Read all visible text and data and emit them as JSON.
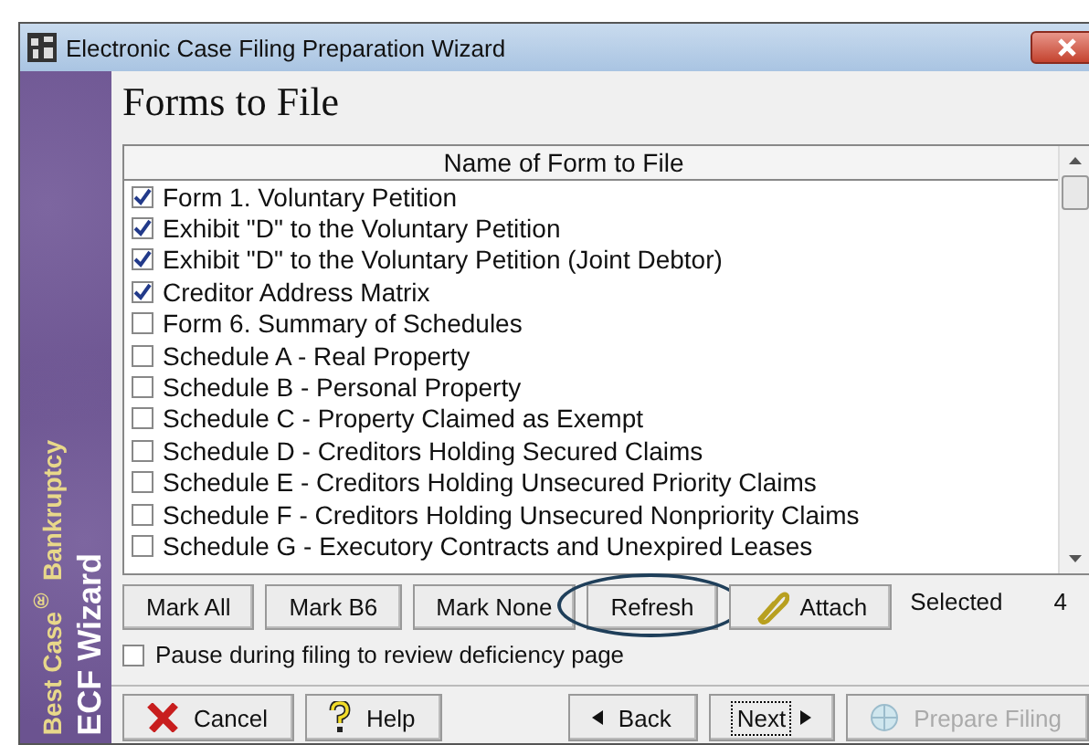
{
  "window": {
    "title": "Electronic Case Filing Preparation Wizard"
  },
  "sidebar": {
    "brand": "Best Case$^{®}$ Bankruptcy",
    "product": "ECF Wizard"
  },
  "heading": "Forms to File",
  "list": {
    "column": "Name of Form to File",
    "rows": [
      {
        "label": "Form 1. Voluntary Petition",
        "checked": true
      },
      {
        "label": "Exhibit \"D\" to the Voluntary Petition",
        "checked": true
      },
      {
        "label": "Exhibit \"D\" to the Voluntary Petition (Joint Debtor)",
        "checked": true
      },
      {
        "label": "Creditor Address Matrix",
        "checked": true
      },
      {
        "label": "Form 6. Summary of Schedules",
        "checked": false
      },
      {
        "label": "Schedule A - Real Property",
        "checked": false
      },
      {
        "label": "Schedule B - Personal Property",
        "checked": false
      },
      {
        "label": "Schedule C - Property Claimed as Exempt",
        "checked": false
      },
      {
        "label": "Schedule D - Creditors Holding Secured Claims",
        "checked": false
      },
      {
        "label": "Schedule E - Creditors Holding Unsecured Priority Claims",
        "checked": false
      },
      {
        "label": "Schedule F - Creditors Holding Unsecured Nonpriority Claims",
        "checked": false
      },
      {
        "label": "Schedule G - Executory Contracts and Unexpired Leases",
        "checked": false
      }
    ]
  },
  "actions": [
    {
      "label": "Mark All",
      "kind": "plain",
      "circled": false
    },
    {
      "label": "Mark B6",
      "kind": "plain",
      "circled": false
    },
    {
      "label": "Mark None",
      "kind": "plain",
      "circled": false
    },
    {
      "label": "Refresh",
      "kind": "plain",
      "circled": true
    },
    {
      "label": "Attach",
      "kind": "clip",
      "circled": false
    }
  ],
  "selected": {
    "label": "Selected",
    "count": "4"
  },
  "pause": {
    "label": "Pause during filing to review deficiency page",
    "checked": false
  },
  "footer": [
    {
      "label": "Cancel",
      "kind": "cancel",
      "disabled": false,
      "focused": false
    },
    {
      "label": "Help",
      "kind": "help",
      "disabled": false,
      "focused": false
    },
    {
      "label": "Back",
      "kind": "back",
      "disabled": false,
      "focused": false
    },
    {
      "label": "Next",
      "kind": "next",
      "disabled": false,
      "focused": true
    },
    {
      "label": "Prepare Filing",
      "kind": "prepare",
      "disabled": true,
      "focused": false
    }
  ]
}
